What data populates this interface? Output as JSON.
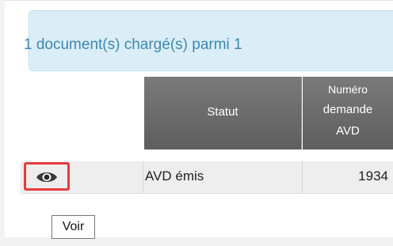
{
  "banner": {
    "text": "1 document(s) chargé(s) parmi 1"
  },
  "table": {
    "columns": [
      {
        "label": "Statut"
      },
      {
        "lines": [
          "Numéro",
          "demande",
          "AVD"
        ]
      }
    ],
    "rows": [
      {
        "action_icon": "eye-icon",
        "status": "AVD émis",
        "numero": "1934"
      }
    ]
  },
  "tooltip": {
    "text": "Voir"
  },
  "colors": {
    "banner_bg": "#dbeef7",
    "banner_text": "#3d87b3",
    "header_bg": "#6b6b6b",
    "highlight": "#e53b3b"
  }
}
